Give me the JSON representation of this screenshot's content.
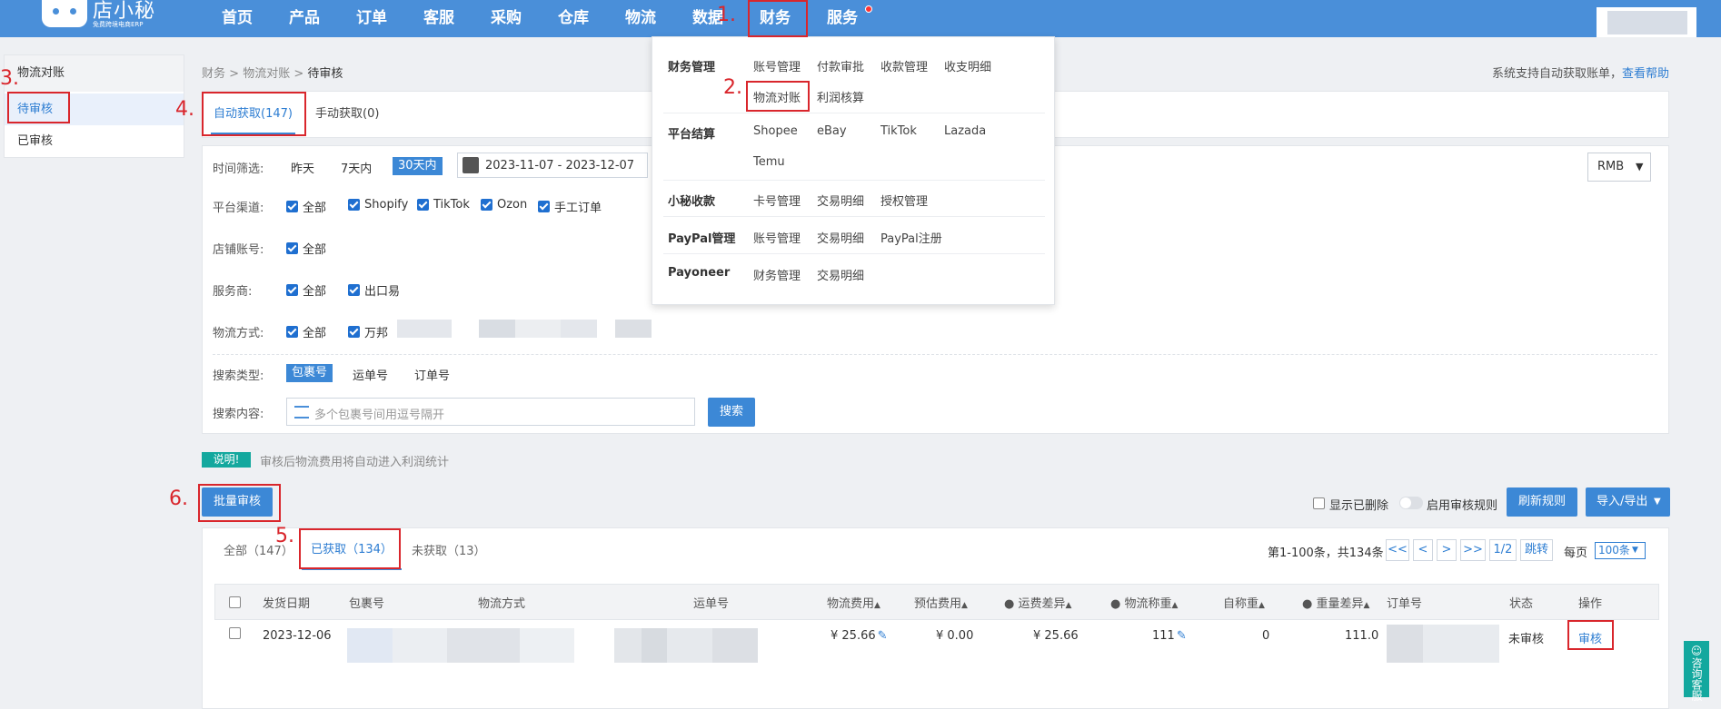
{
  "brand": {
    "title": "店小秘",
    "subtitle": "免费跨境电商ERP"
  },
  "nav": {
    "items": [
      "首页",
      "产品",
      "订单",
      "客服",
      "采购",
      "仓库",
      "物流",
      "数据",
      "财务",
      "服务"
    ]
  },
  "step_labels": [
    "1.",
    "2.",
    "3.",
    "4.",
    "5.",
    "6."
  ],
  "dropdown": {
    "groups": [
      {
        "title": "财务管理",
        "items": [
          "账号管理",
          "付款审批",
          "收款管理",
          "收支明细",
          "物流对账",
          "利润核算"
        ]
      },
      {
        "title": "平台结算",
        "items": [
          "Shopee",
          "eBay",
          "TikTok",
          "Lazada",
          "Temu"
        ]
      },
      {
        "title": "小秘收款",
        "items": [
          "卡号管理",
          "交易明细",
          "授权管理"
        ]
      },
      {
        "title": "PayPal管理",
        "items": [
          "账号管理",
          "交易明细",
          "PayPal注册"
        ]
      },
      {
        "title": "Payoneer",
        "items": [
          "财务管理",
          "交易明细"
        ]
      }
    ]
  },
  "sidebar": {
    "title": "物流对账",
    "items": [
      "待审核",
      "已审核"
    ]
  },
  "breadcrumb": {
    "a": "财务",
    "sep": ">",
    "b": "物流对账",
    "c": "待审核"
  },
  "help": {
    "text": "系统支持自动获取账单，",
    "link": "查看帮助"
  },
  "subtabs": [
    "自动获取(147)",
    "手动获取(0)"
  ],
  "filters": {
    "time_label": "时间筛选:",
    "time_options": [
      "昨天",
      "7天内",
      "30天内"
    ],
    "date_range": "2023-11-07 - 2023-12-07",
    "currency": "RMB",
    "platform_label": "平台渠道:",
    "platforms": [
      "全部",
      "Shopify",
      "TikTok",
      "Ozon",
      "手工订单"
    ],
    "store_label": "店铺账号:",
    "store_options": [
      "全部"
    ],
    "provider_label": "服务商:",
    "providers": [
      "全部",
      "出口易"
    ],
    "method_label": "物流方式:",
    "methods": [
      "全部",
      "万邦"
    ],
    "search_type_label": "搜索类型:",
    "search_types": [
      "包裹号",
      "运单号",
      "订单号"
    ],
    "search_content_label": "搜索内容:",
    "search_placeholder": "多个包裹号间用逗号隔开",
    "search_button": "搜索"
  },
  "note": {
    "badge": "说明!",
    "text": "审核后物流费用将自动进入利润统计"
  },
  "toolbar": {
    "batch": "批量审核",
    "show_deleted": "显示已删除",
    "rule_toggle": "启用审核规则",
    "refresh": "刷新规则",
    "import_export": "导入/导出"
  },
  "list_tabs": [
    "全部（147）",
    "已获取（134）",
    "未获取（13）"
  ],
  "pagination": {
    "summary": "第1-100条，共134条",
    "first": "<<",
    "prev": "<",
    "next": ">",
    "last": ">>",
    "page": "1/2",
    "jump": "跳转",
    "per_page_label": "每页",
    "per_page": "100条"
  },
  "table": {
    "headers": [
      "发货日期",
      "包裹号",
      "物流方式",
      "运单号",
      "物流费用",
      "预估费用",
      "运费差异",
      "物流称重",
      "自称重",
      "重量差异",
      "订单号",
      "状态",
      "操作"
    ],
    "rows": [
      {
        "date": "2023-12-06",
        "fee": "¥ 25.66",
        "est": "¥ 0.00",
        "diff": "¥ 25.66",
        "weight": "111",
        "self_weight": "0",
        "weight_diff": "111.0",
        "status": "未审核",
        "action": "审核"
      }
    ]
  },
  "consult": "咨询客服",
  "colors": {
    "nav_bg": "#4a8fd9",
    "accent": "#3c88d6",
    "highlight": "#d9262c",
    "note_badge": "#13a89e"
  }
}
